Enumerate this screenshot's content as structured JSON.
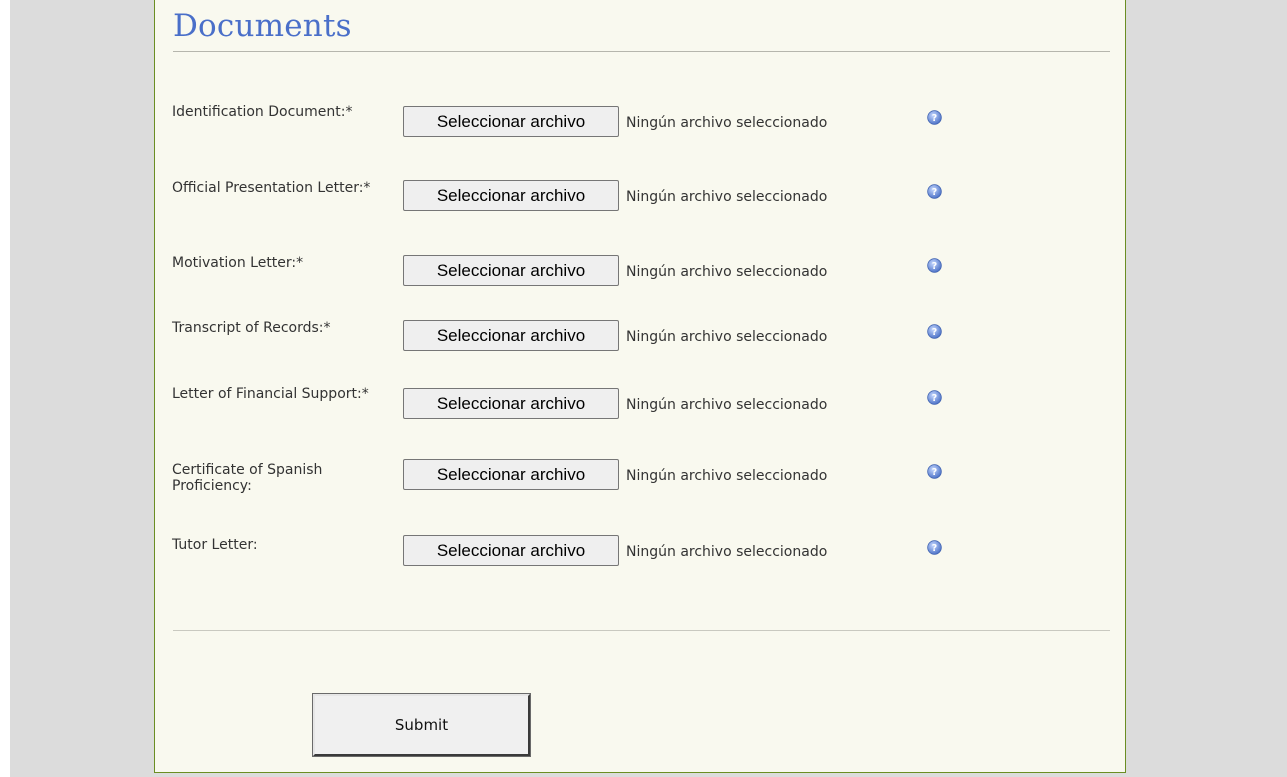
{
  "form": {
    "section_title": "Documents",
    "file_button_label": "Seleccionar archivo",
    "no_file_text": "Ningún archivo seleccionado",
    "submit_label": "Submit",
    "help_icon": "question-circle-icon",
    "colors": {
      "title": "#4a6fc9",
      "panel_background": "#f9f9ef",
      "panel_border": "#6b8e23",
      "page_background": "#dcdcdc"
    },
    "fields": [
      {
        "label": "Identification Document:*"
      },
      {
        "label": "Official Presentation Letter:*"
      },
      {
        "label": "Motivation Letter:*"
      },
      {
        "label": "Transcript of Records:*"
      },
      {
        "label": "Letter of Financial Support:*"
      },
      {
        "label": "Certificate of Spanish Proficiency:"
      },
      {
        "label": "Tutor Letter:"
      }
    ]
  }
}
